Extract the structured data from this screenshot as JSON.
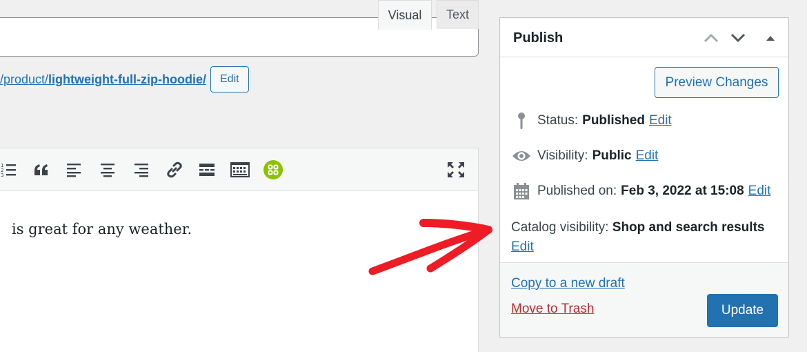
{
  "permalink": {
    "url_prefix": "/product/",
    "slug": "lightweight-full-zip-hoodie/",
    "edit_label": "Edit"
  },
  "editor": {
    "tabs": [
      {
        "label": "Visual",
        "active": true
      },
      {
        "label": "Text",
        "active": false
      }
    ],
    "toolbar_icons": [
      "numbered-list-icon",
      "blockquote-icon",
      "align-left-icon",
      "align-center-icon",
      "align-right-icon",
      "link-icon",
      "read-more-icon",
      "keyboard-shortcuts-icon",
      "plugin-grid-icon",
      "fullscreen-icon"
    ],
    "content": "is great for any weather."
  },
  "publish": {
    "title": "Publish",
    "preview_label": "Preview Changes",
    "status_label": "Status:",
    "status_value": "Published",
    "visibility_label": "Visibility:",
    "visibility_value": "Public",
    "published_label": "Published on:",
    "published_value": "Feb 3, 2022 at 15:08",
    "catalog_label": "Catalog visibility:",
    "catalog_value": "Shop and search results",
    "edit_label": "Edit",
    "copy_label": "Copy to a new draft",
    "trash_label": "Move to Trash",
    "update_label": "Update"
  },
  "colors": {
    "accent": "#2271b1",
    "danger": "#b32d2e",
    "arrow": "#ee1c25",
    "plugin": "#8cc100"
  }
}
